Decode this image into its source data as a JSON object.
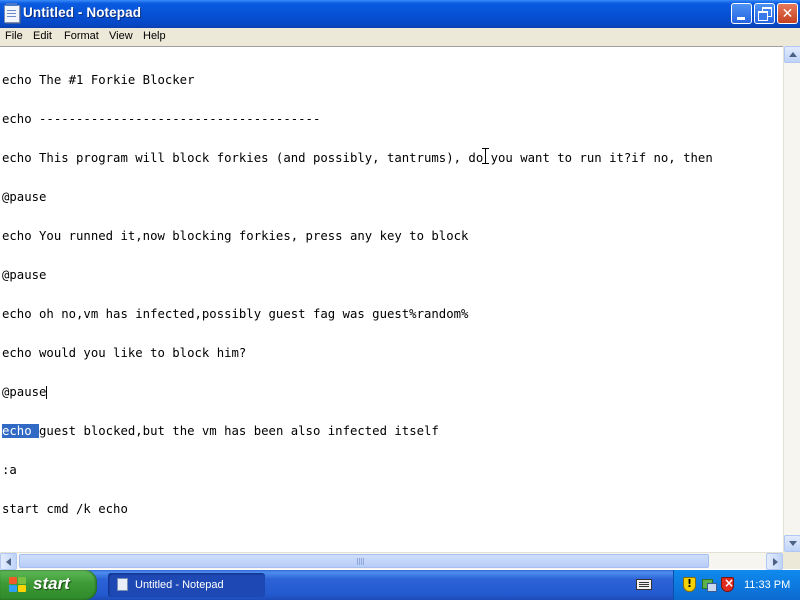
{
  "window": {
    "title": "Untitled - Notepad"
  },
  "menu": [
    "File",
    "Edit",
    "Format",
    "View",
    "Help"
  ],
  "editor": {
    "lines": [
      "echo The #1 Forkie Blocker",
      "echo --------------------------------------",
      "echo This program will block forkies (and possibly, tantrums), do you want to run it?if no, then",
      "@pause",
      "echo You runned it,now blocking forkies, press any key to block",
      "@pause",
      "echo oh no,vm has infected,possibly guest fag was guest%random%",
      "echo would you like to block him?",
      "@pause",
      "guest blocked,but the vm has been also infected itself",
      ":a",
      "start cmd /k echo"
    ],
    "selected_text": "echo "
  },
  "taskbar": {
    "start_label": "start",
    "task_label": "Untitled - Notepad",
    "clock": "11:33 PM"
  },
  "icons": {
    "app": "notepad-icon",
    "tray": [
      "keyboard-icon",
      "security-alert-icon",
      "network-icon",
      "security-center-icon"
    ]
  },
  "colors": {
    "titlebar": "#0552d6",
    "selection": "#316ac5",
    "start_button": "#3d9a35",
    "taskbar": "#245ad0"
  }
}
